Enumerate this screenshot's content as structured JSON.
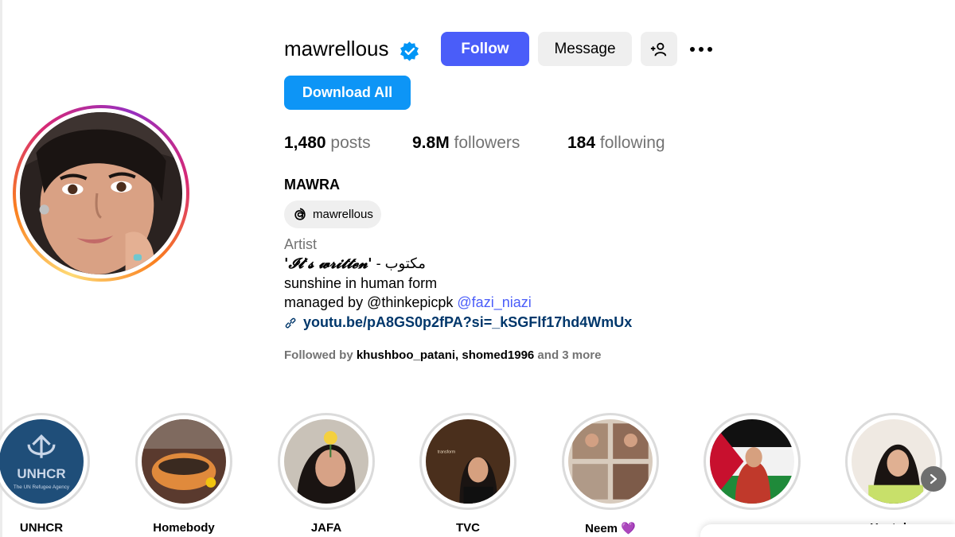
{
  "profile": {
    "username": "mawrellous",
    "verified": true,
    "follow_label": "Follow",
    "message_label": "Message",
    "download_label": "Download All",
    "stats": {
      "posts_value": "1,480",
      "posts_label": "posts",
      "followers_value": "9.8M",
      "followers_label": "followers",
      "following_value": "184",
      "following_label": "following"
    },
    "full_name": "MAWRA",
    "threads_handle": "mawrellous",
    "category": "Artist",
    "bio": {
      "line1_quote": "'𝓘𝓽'𝓼 𝔀𝓻𝓲𝓽𝓽𝓮𝓷'",
      "line1_rest": " - مکتوب",
      "line2": "sunshine in human form",
      "line3_text": "managed by @thinkepicpk ",
      "line3_mention": "@fazi_niazi"
    },
    "link": "youtu.be/pA8GS0p2fPA?si=_kSGFlf17hd4WmUx",
    "followed_by": {
      "prefix": "Followed by ",
      "user1": "khushboo_patani",
      "separator": ", ",
      "user2": "shomed1996",
      "suffix": " and 3 more"
    }
  },
  "highlights": [
    {
      "label": "UNHCR"
    },
    {
      "label": "Homebody"
    },
    {
      "label": "JAFA"
    },
    {
      "label": "TVC"
    },
    {
      "label": "Neem 💜"
    },
    {
      "label": ""
    },
    {
      "label": "Youtube"
    }
  ],
  "colors": {
    "follow_button": "#4a5df9",
    "download_button": "#0d95f6",
    "verified_badge": "#0095f6",
    "link": "#00376b",
    "mention": "#4a5df9"
  }
}
